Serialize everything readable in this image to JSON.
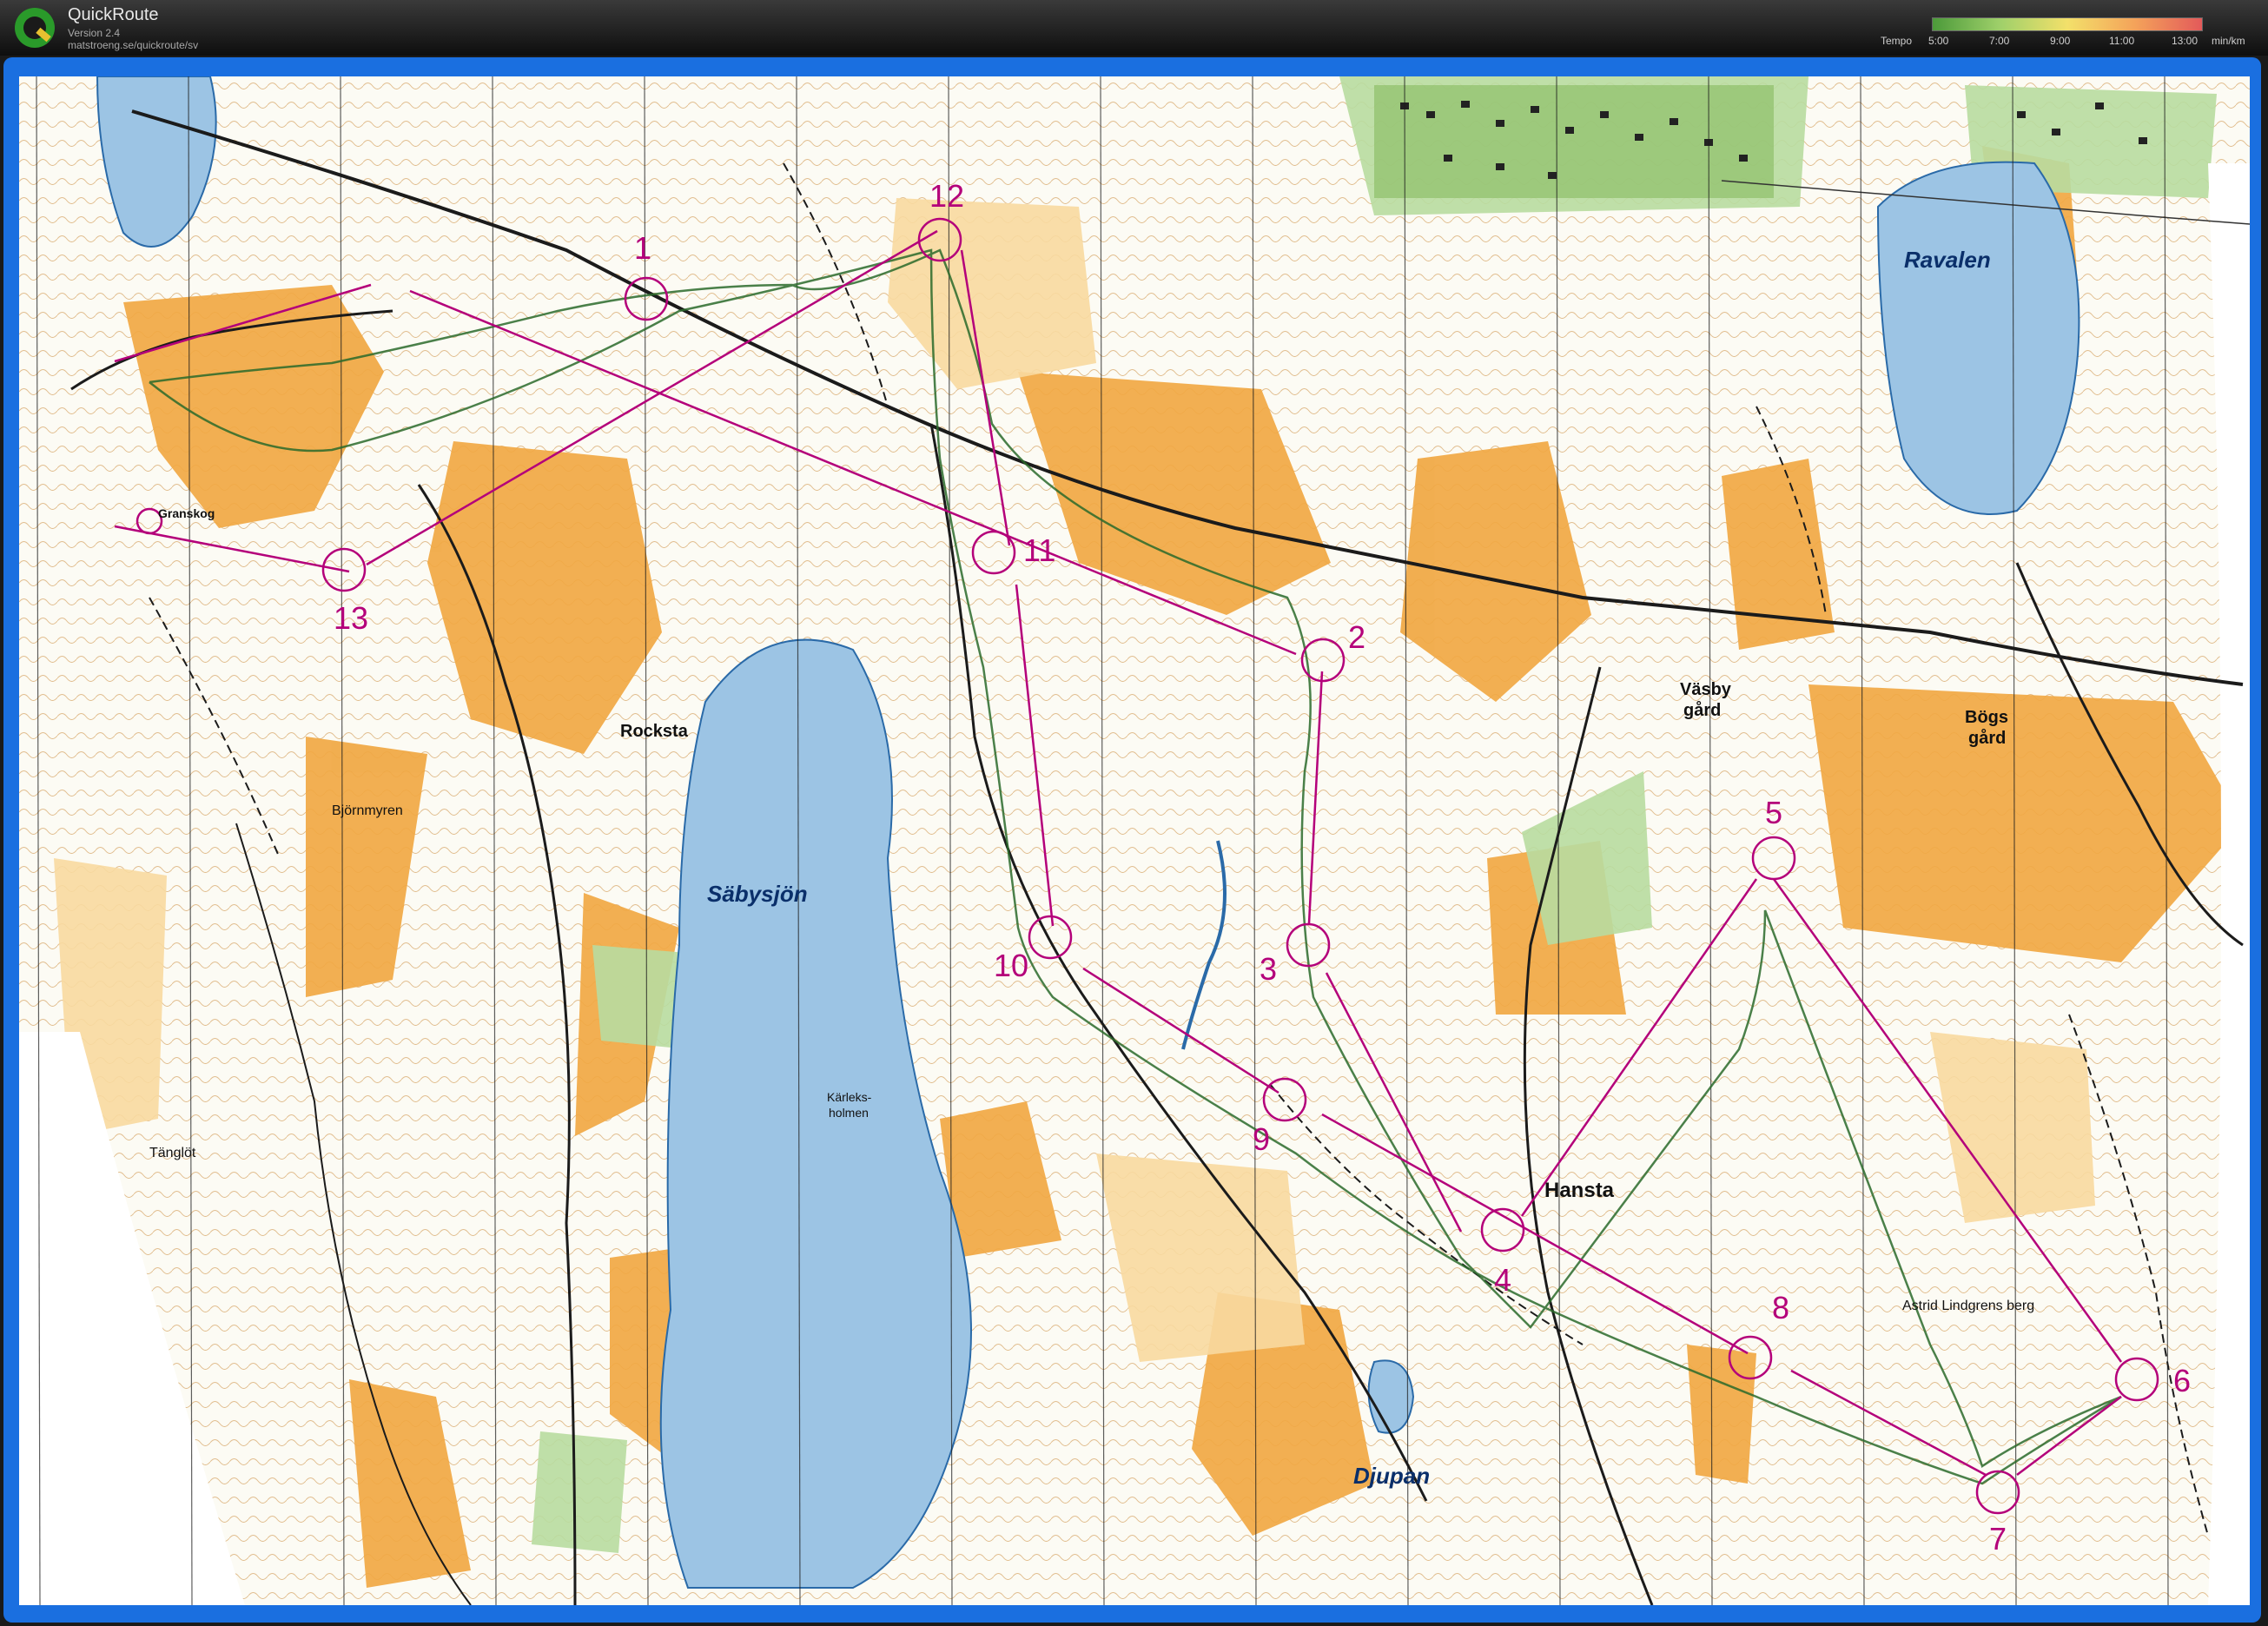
{
  "app": {
    "name": "QuickRoute",
    "version": "Version 2.4",
    "url": "matstroeng.se/quickroute/sv"
  },
  "tempo_legend": {
    "label": "Tempo",
    "ticks": [
      "5:00",
      "7:00",
      "9:00",
      "11:00",
      "13:00"
    ],
    "unit": "min/km"
  },
  "map": {
    "place_names": {
      "ravalen": "Ravalen",
      "ranskog": "Granskog",
      "rockstad": "Rocksta",
      "bjornmyren": "Björnmyren",
      "sabysjon": "Säbysjön",
      "tanglot": "Tänglöt",
      "karleksholmen_1": "Kärleks-",
      "karleksholmen_2": "holmen",
      "vasby_1": "Väsby",
      "vasby_2": "gård",
      "bogs_1": "Bögs",
      "bogs_2": "gård",
      "hansta": "Hansta",
      "astrid": "Astrid Lindgrens berg",
      "djupan": "Djupan"
    },
    "controls": [
      "1",
      "2",
      "3",
      "4",
      "5",
      "6",
      "7",
      "8",
      "9",
      "10",
      "11",
      "12",
      "13"
    ],
    "course_color": "#b4007a",
    "track_color": "#2a6a2a"
  }
}
